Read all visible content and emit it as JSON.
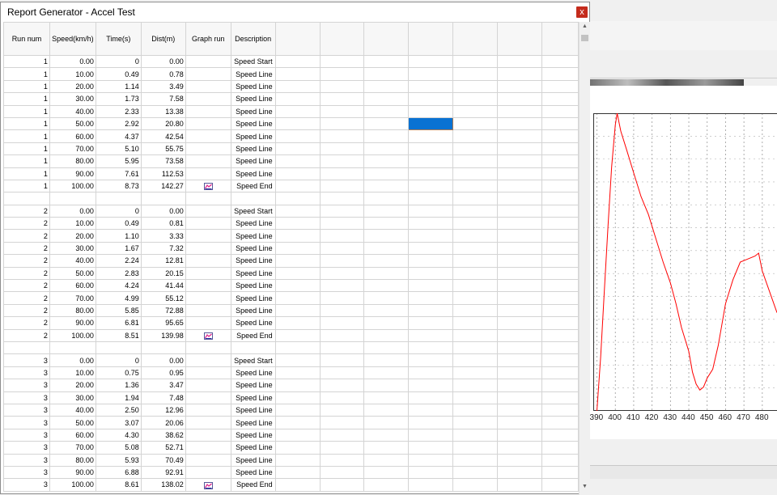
{
  "window": {
    "title": "Report Generator - Accel Test",
    "close_label": "x"
  },
  "table": {
    "headers": [
      "Run num",
      "Speed(km/h)",
      "Time(s)",
      "Dist(m)",
      "Graph run",
      "Description"
    ],
    "empty_columns": 7,
    "rows": [
      {
        "run": "1",
        "speed": "0.00",
        "time": "0",
        "dist": "0.00",
        "graph": false,
        "desc": "Speed Start"
      },
      {
        "run": "1",
        "speed": "10.00",
        "time": "0.49",
        "dist": "0.78",
        "graph": false,
        "desc": "Speed Line"
      },
      {
        "run": "1",
        "speed": "20.00",
        "time": "1.14",
        "dist": "3.49",
        "graph": false,
        "desc": "Speed Line"
      },
      {
        "run": "1",
        "speed": "30.00",
        "time": "1.73",
        "dist": "7.58",
        "graph": false,
        "desc": "Speed Line"
      },
      {
        "run": "1",
        "speed": "40.00",
        "time": "2.33",
        "dist": "13.38",
        "graph": false,
        "desc": "Speed Line"
      },
      {
        "run": "1",
        "speed": "50.00",
        "time": "2.92",
        "dist": "20.80",
        "graph": false,
        "desc": "Speed Line",
        "selected_col": 9
      },
      {
        "run": "1",
        "speed": "60.00",
        "time": "4.37",
        "dist": "42.54",
        "graph": false,
        "desc": "Speed Line"
      },
      {
        "run": "1",
        "speed": "70.00",
        "time": "5.10",
        "dist": "55.75",
        "graph": false,
        "desc": "Speed Line"
      },
      {
        "run": "1",
        "speed": "80.00",
        "time": "5.95",
        "dist": "73.58",
        "graph": false,
        "desc": "Speed Line"
      },
      {
        "run": "1",
        "speed": "90.00",
        "time": "7.61",
        "dist": "112.53",
        "graph": false,
        "desc": "Speed Line"
      },
      {
        "run": "1",
        "speed": "100.00",
        "time": "8.73",
        "dist": "142.27",
        "graph": true,
        "desc": "Speed End"
      },
      {
        "blank": true
      },
      {
        "run": "2",
        "speed": "0.00",
        "time": "0",
        "dist": "0.00",
        "graph": false,
        "desc": "Speed Start"
      },
      {
        "run": "2",
        "speed": "10.00",
        "time": "0.49",
        "dist": "0.81",
        "graph": false,
        "desc": "Speed Line"
      },
      {
        "run": "2",
        "speed": "20.00",
        "time": "1.10",
        "dist": "3.33",
        "graph": false,
        "desc": "Speed Line"
      },
      {
        "run": "2",
        "speed": "30.00",
        "time": "1.67",
        "dist": "7.32",
        "graph": false,
        "desc": "Speed Line"
      },
      {
        "run": "2",
        "speed": "40.00",
        "time": "2.24",
        "dist": "12.81",
        "graph": false,
        "desc": "Speed Line"
      },
      {
        "run": "2",
        "speed": "50.00",
        "time": "2.83",
        "dist": "20.15",
        "graph": false,
        "desc": "Speed Line"
      },
      {
        "run": "2",
        "speed": "60.00",
        "time": "4.24",
        "dist": "41.44",
        "graph": false,
        "desc": "Speed Line"
      },
      {
        "run": "2",
        "speed": "70.00",
        "time": "4.99",
        "dist": "55.12",
        "graph": false,
        "desc": "Speed Line"
      },
      {
        "run": "2",
        "speed": "80.00",
        "time": "5.85",
        "dist": "72.88",
        "graph": false,
        "desc": "Speed Line"
      },
      {
        "run": "2",
        "speed": "90.00",
        "time": "6.81",
        "dist": "95.65",
        "graph": false,
        "desc": "Speed Line"
      },
      {
        "run": "2",
        "speed": "100.00",
        "time": "8.51",
        "dist": "139.98",
        "graph": true,
        "desc": "Speed End"
      },
      {
        "blank": true
      },
      {
        "run": "3",
        "speed": "0.00",
        "time": "0",
        "dist": "0.00",
        "graph": false,
        "desc": "Speed Start"
      },
      {
        "run": "3",
        "speed": "10.00",
        "time": "0.75",
        "dist": "0.95",
        "graph": false,
        "desc": "Speed Line"
      },
      {
        "run": "3",
        "speed": "20.00",
        "time": "1.36",
        "dist": "3.47",
        "graph": false,
        "desc": "Speed Line"
      },
      {
        "run": "3",
        "speed": "30.00",
        "time": "1.94",
        "dist": "7.48",
        "graph": false,
        "desc": "Speed Line"
      },
      {
        "run": "3",
        "speed": "40.00",
        "time": "2.50",
        "dist": "12.96",
        "graph": false,
        "desc": "Speed Line"
      },
      {
        "run": "3",
        "speed": "50.00",
        "time": "3.07",
        "dist": "20.06",
        "graph": false,
        "desc": "Speed Line"
      },
      {
        "run": "3",
        "speed": "60.00",
        "time": "4.30",
        "dist": "38.62",
        "graph": false,
        "desc": "Speed Line"
      },
      {
        "run": "3",
        "speed": "70.00",
        "time": "5.08",
        "dist": "52.71",
        "graph": false,
        "desc": "Speed Line"
      },
      {
        "run": "3",
        "speed": "80.00",
        "time": "5.93",
        "dist": "70.49",
        "graph": false,
        "desc": "Speed Line"
      },
      {
        "run": "3",
        "speed": "90.00",
        "time": "6.88",
        "dist": "92.91",
        "graph": false,
        "desc": "Speed Line"
      },
      {
        "run": "3",
        "speed": "100.00",
        "time": "8.61",
        "dist": "138.02",
        "graph": true,
        "desc": "Speed End"
      }
    ]
  },
  "background_plot": {
    "x_tick_labels": [
      "390",
      "400",
      "410",
      "420",
      "430",
      "440",
      "450",
      "460",
      "470",
      "480"
    ],
    "line_color": "#ff0000",
    "series_x": [
      390,
      392,
      394,
      396,
      398,
      400,
      401,
      403,
      406,
      410,
      414,
      418,
      422,
      426,
      430,
      433,
      436,
      440,
      442,
      444,
      446,
      448,
      450,
      453,
      456,
      460,
      464,
      468,
      472,
      476,
      478,
      480,
      484,
      488
    ],
    "series_y": [
      0,
      18,
      40,
      62,
      82,
      96,
      100,
      94,
      88,
      80,
      72,
      66,
      58,
      50,
      43,
      36,
      28,
      20,
      13,
      9,
      7,
      8,
      11,
      14,
      22,
      36,
      44,
      50,
      51,
      52,
      53,
      47,
      40,
      33
    ]
  },
  "colors": {
    "selection": "#0a72d2",
    "close_button": "#c42b1c",
    "plot_line": "#ff0000"
  },
  "icons": {
    "graph_run": "chart-icon"
  }
}
